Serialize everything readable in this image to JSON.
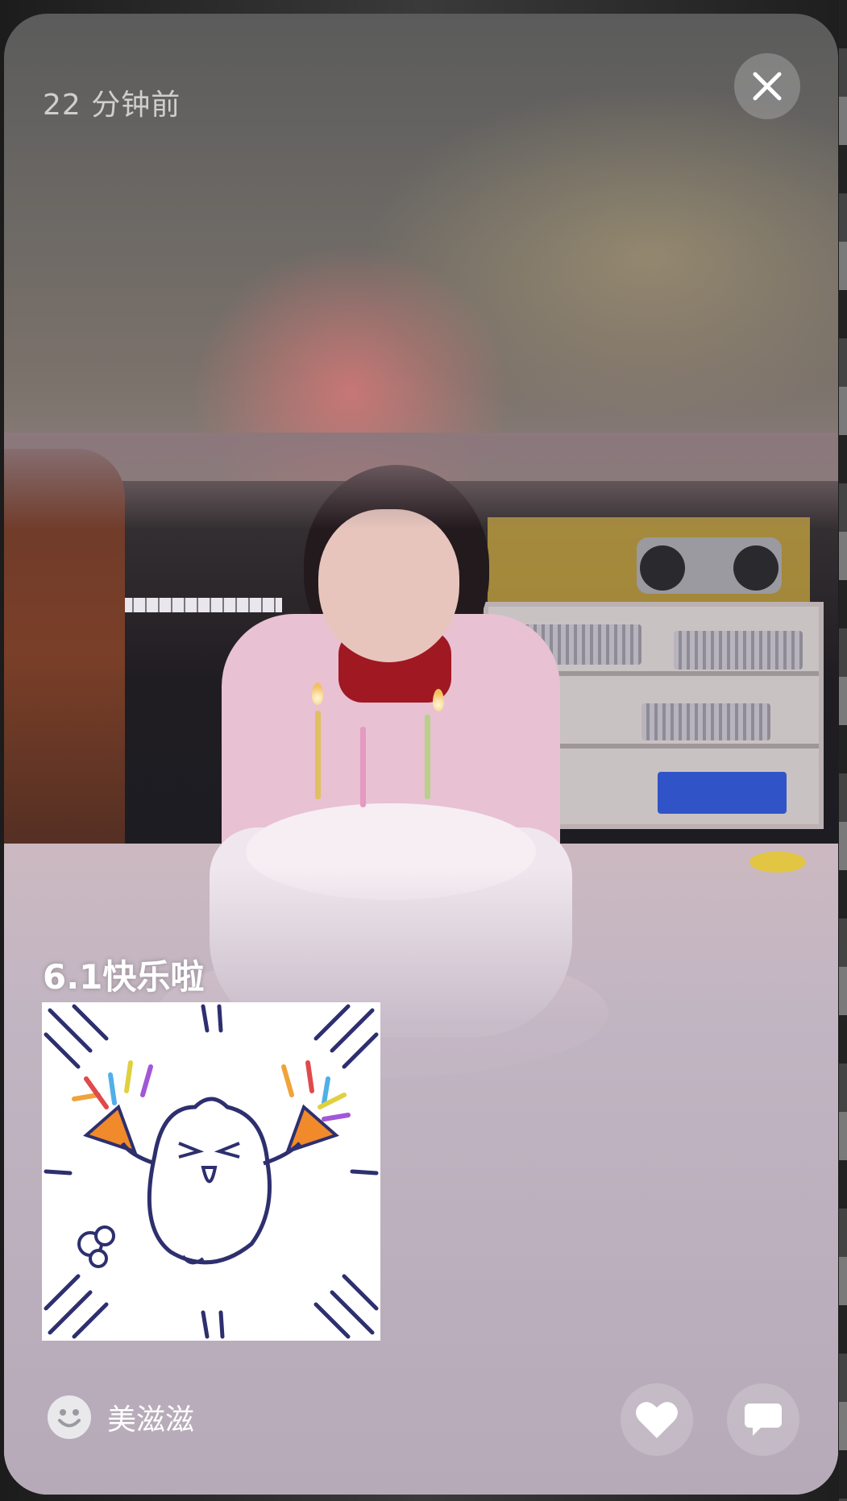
{
  "post": {
    "timestamp": "22 分钟前",
    "caption": "6.1快乐啦",
    "photo_alt": "birthday-cake-photo",
    "sticker_alt": "party-bird-sticker"
  },
  "author": {
    "name": "美滋滋",
    "avatar_icon": "smile-face-icon"
  },
  "actions": {
    "close_icon": "close-icon",
    "like_icon": "heart-icon",
    "comment_icon": "comment-icon"
  },
  "colors": {
    "text_primary": "#ffffff",
    "timestamp_text": "#cfcfcf",
    "button_bg": "rgba(160,160,160,0.55)"
  }
}
